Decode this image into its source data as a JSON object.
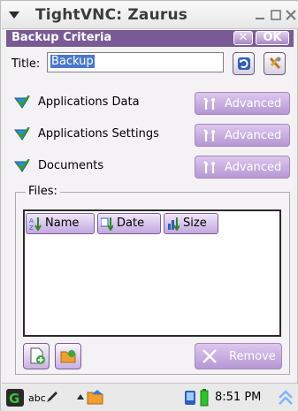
{
  "window": {
    "title": "TightVNC: Zaurus"
  },
  "dialog": {
    "caption": "Backup Criteria",
    "close_label": "✕",
    "ok_label": "OK",
    "title_label": "Title:",
    "title_value": "Backup"
  },
  "options": [
    {
      "label": "Applications Data",
      "checked": true,
      "advanced": "Advanced"
    },
    {
      "label": "Applications Settings",
      "checked": true,
      "advanced": "Advanced"
    },
    {
      "label": "Documents",
      "checked": true,
      "advanced": "Advanced"
    }
  ],
  "files": {
    "legend": "Files:",
    "columns": [
      "Name",
      "Date",
      "Size"
    ],
    "remove_label": "Remove"
  },
  "taskbar": {
    "input_mode": "abc",
    "time": "8:51 PM"
  },
  "colors": {
    "accent": "#7a5a95",
    "button_disabled": "#c6a9e0"
  }
}
